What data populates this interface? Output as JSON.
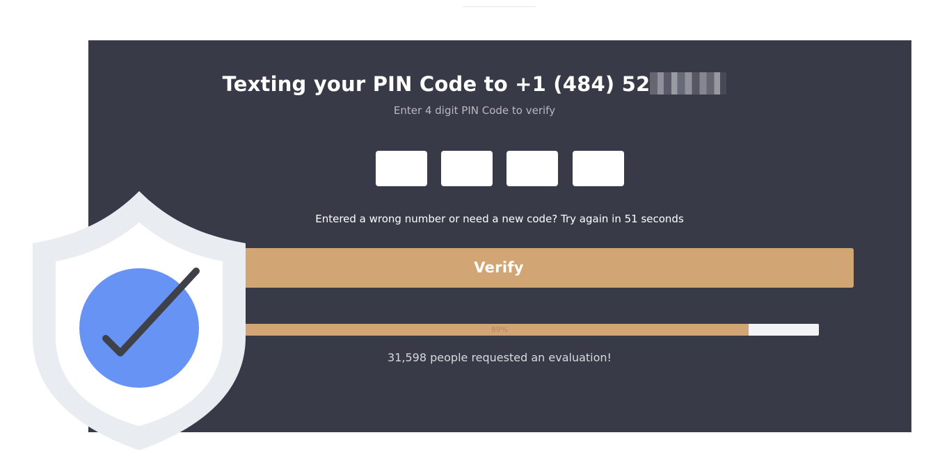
{
  "header": {
    "title_text": "Texting your PIN Code to +1 (484) 52",
    "subtitle": "Enter 4 digit PIN Code to verify"
  },
  "pin_inputs": [
    {
      "value": ""
    },
    {
      "value": ""
    },
    {
      "value": ""
    },
    {
      "value": ""
    }
  ],
  "retry_text": "Entered a wrong number or need a new code? Try again in 51 seconds",
  "verify_button_label": "Verify",
  "progress": {
    "label": "89%",
    "value": 89
  },
  "counter_text": "31,598 people requested an evaluation!",
  "colors": {
    "panel_background": "#393a47",
    "accent": "#d2a574",
    "shield_outer": "#e9ecf0",
    "shield_inner": "#ffffff",
    "check_circle": "#6794f4",
    "check_mark": "#3f4149"
  },
  "icons": {
    "shield": "shield-check-icon"
  }
}
